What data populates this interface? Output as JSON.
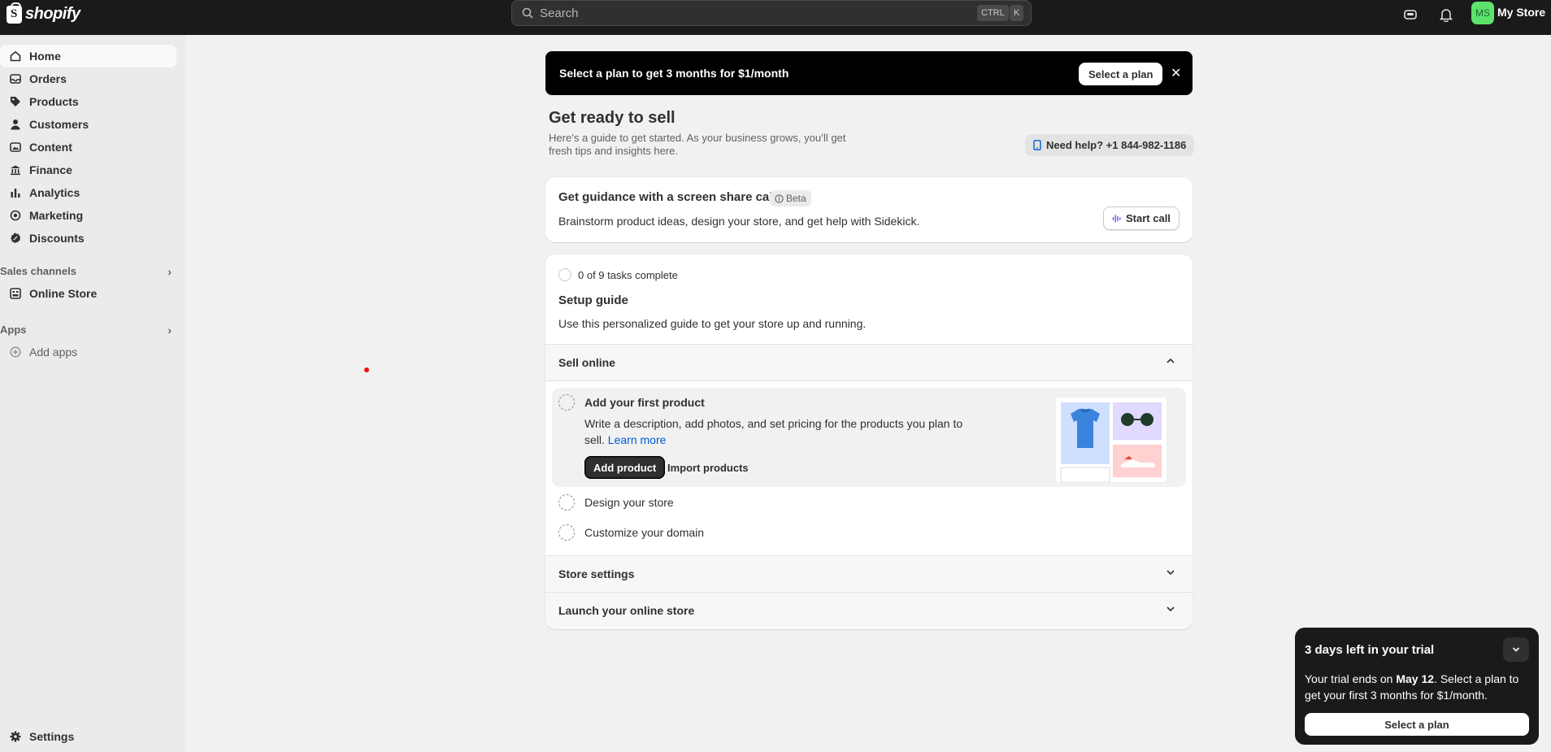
{
  "topbar": {
    "logo_text": "shopify",
    "search_placeholder": "Search",
    "kbd_ctrl": "CTRL",
    "kbd_k": "K",
    "avatar_initials": "MS",
    "store_name": "My Store"
  },
  "sidebar": {
    "items": [
      {
        "label": "Home",
        "icon": "home-icon"
      },
      {
        "label": "Orders",
        "icon": "orders-icon"
      },
      {
        "label": "Products",
        "icon": "tag-icon"
      },
      {
        "label": "Customers",
        "icon": "person-icon"
      },
      {
        "label": "Content",
        "icon": "content-icon"
      },
      {
        "label": "Finance",
        "icon": "bank-icon"
      },
      {
        "label": "Analytics",
        "icon": "bar-chart-icon"
      },
      {
        "label": "Marketing",
        "icon": "target-icon"
      },
      {
        "label": "Discounts",
        "icon": "discount-icon"
      }
    ],
    "sales_channels_label": "Sales channels",
    "online_store_label": "Online Store",
    "apps_label": "Apps",
    "add_apps_label": "Add apps",
    "settings_label": "Settings"
  },
  "banner": {
    "text": "Select a plan to get 3 months for $1/month",
    "button": "Select a plan"
  },
  "page": {
    "title": "Get ready to sell",
    "subtitle": "Here’s a guide to get started. As your business grows, you’ll get fresh tips and insights here.",
    "help": "Need help? +1 844-982-1186"
  },
  "screen_share": {
    "title": "Get guidance with a screen share call",
    "badge": "Beta",
    "description": "Brainstorm product ideas, design your store, and get help with Sidekick.",
    "button": "Start call"
  },
  "setup": {
    "progress": "0 of 9 tasks complete",
    "title": "Setup guide",
    "subtitle": "Use this personalized guide to get your store up and running.",
    "sections": [
      "Sell online",
      "Store settings",
      "Launch your online store"
    ],
    "active_task": {
      "title": "Add your first product",
      "description": "Write a description, add photos, and set pricing for the products you plan to sell.",
      "link": "Learn more",
      "primary": "Add product",
      "secondary": "Import products"
    },
    "tasks": [
      "Design your store",
      "Customize your domain"
    ]
  },
  "trial": {
    "title": "3 days left in your trial",
    "body_prefix": "Your trial ends on ",
    "body_date": "May 12",
    "body_suffix": ". Select a plan to get your first 3 months for $1/month.",
    "button": "Select a plan"
  }
}
